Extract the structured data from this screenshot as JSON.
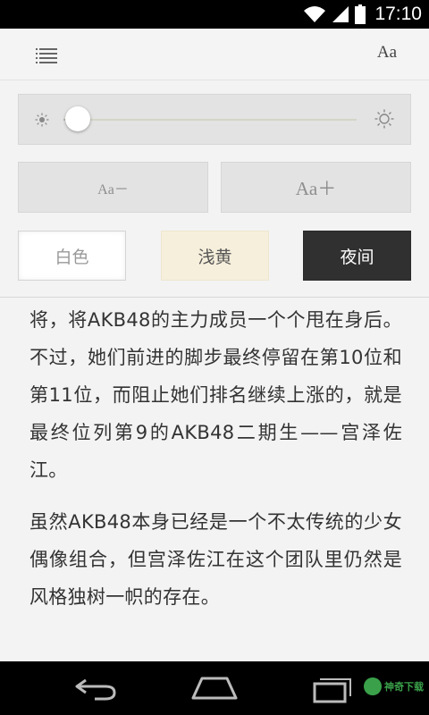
{
  "status_bar": {
    "time": "17:10",
    "icons": [
      "wifi-icon",
      "signal-icon",
      "battery-icon"
    ]
  },
  "toolbar": {
    "toc_icon": "list-icon",
    "font_menu_label": "Aa"
  },
  "settings": {
    "brightness": {
      "min_icon": "sun-small-icon",
      "max_icon": "sun-large-icon",
      "level": 0.05
    },
    "font_decrease_label": "Aa－",
    "font_increase_label": "Aa＋",
    "themes": [
      {
        "label": "白色",
        "color": "#ffffff"
      },
      {
        "label": "浅黄",
        "color": "#f6efdc"
      },
      {
        "label": "夜间",
        "color": "#303030"
      }
    ]
  },
  "content": {
    "paragraphs": [
      "将，将AKB48的主力成员一个个甩在身后。不过，她们前进的脚步最终停留在第10位和第11位，而阻止她们排名继续上涨的，就是最终位列第9的AKB48二期生——宫泽佐江。",
      "虽然AKB48本身已经是一个不太传统的少女偶像组合，但宫泽佐江在这个团队里仍然是风格独树一帜的存在。"
    ]
  },
  "nav_bar": {
    "buttons": [
      "back-icon",
      "home-icon",
      "recent-apps-icon"
    ],
    "watermark_text": "神奇下载"
  },
  "colors": {
    "accent_green": "#3aa14a",
    "night": "#303030",
    "light_yellow": "#f6efdc"
  }
}
